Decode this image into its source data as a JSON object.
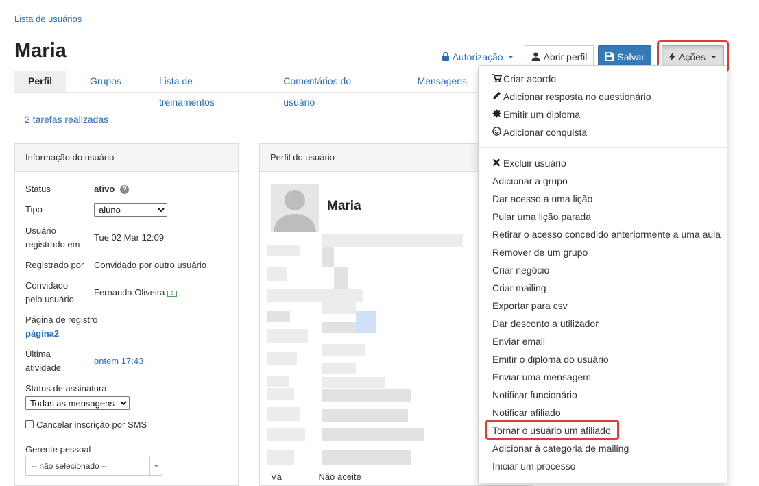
{
  "breadcrumb": "Lista de usuários",
  "title": "Maria",
  "top_actions": {
    "authorization_label": "Autorização",
    "open_profile_label": "Abrir perfil",
    "save_label": "Salvar",
    "actions_label": "Ações"
  },
  "tabs": [
    {
      "label": "Perfil",
      "active": true
    },
    {
      "label": "Grupos"
    },
    {
      "label": "Lista de treinamentos"
    },
    {
      "label": "Comentários do usuário"
    },
    {
      "label": "Mensagens"
    }
  ],
  "tasks_link": "2 tarefas realizadas",
  "user_info": {
    "panel_title": "Informação do usuário",
    "status_label": "Status",
    "status_value": "ativo",
    "type_label": "Tipo",
    "type_value": "aluno",
    "registered_at_label_1": "Usuário",
    "registered_at_label_2": "registrado em",
    "registered_at_value": "Tue 02 Mar 12:09",
    "registered_by_label": "Registrado por",
    "registered_by_value": "Convidado por outro usuário",
    "invited_by_label_1": "Convidado",
    "invited_by_label_2": "pelo usuário",
    "invited_by_value": "Fernanda Oliveira",
    "reg_page_label": "Página de registro",
    "reg_page_value": "página2",
    "last_activity_label_1": "Última",
    "last_activity_label_2": "atividade",
    "last_activity_value": "ontem 17:43",
    "subscription_label": "Status de assinatura",
    "subscription_value": "Todas as mensagens",
    "sms_label": "Cancelar inscrição por SMS",
    "manager_label": "Gerente pessoal",
    "manager_value": "-- não selecionado --"
  },
  "user_profile": {
    "panel_title": "Perfil do usuário",
    "name": "Maria",
    "footer_text_1": "Vá",
    "footer_text_2": "Não aceite"
  },
  "actions_menu": {
    "group1": [
      {
        "label": "Criar acordo",
        "icon": "cart-icon"
      },
      {
        "label": "Adicionar resposta no questionário",
        "icon": "pencil-icon"
      },
      {
        "label": "Emitir um diploma",
        "icon": "certificate-icon"
      },
      {
        "label": "Adicionar conquista",
        "icon": "smile-icon"
      }
    ],
    "group2": [
      {
        "label": "Excluir usuário",
        "icon": "close-icon"
      },
      {
        "label": "Adicionar a grupo"
      },
      {
        "label": "Dar acesso a uma lição"
      },
      {
        "label": "Pular uma lição parada"
      },
      {
        "label": "Retirar o acesso concedido anteriormente a uma aula"
      },
      {
        "label": "Remover de um grupo"
      },
      {
        "label": "Criar negócio"
      },
      {
        "label": "Criar mailing"
      },
      {
        "label": "Exportar para csv"
      },
      {
        "label": "Dar desconto a utilizador"
      },
      {
        "label": "Enviar email"
      },
      {
        "label": "Emitir o diploma do usuário"
      },
      {
        "label": "Enviar uma mensagem"
      },
      {
        "label": "Notificar funcionário"
      },
      {
        "label": "Notificar afiliado"
      },
      {
        "label": "Tornar o usuário um afiliado",
        "highlighted": true
      },
      {
        "label": "Adicionar à categoria de mailing"
      },
      {
        "label": "Iniciar um processo"
      }
    ]
  },
  "colors": {
    "link": "#2a6ebb",
    "primary_button": "#337ab7",
    "highlight": "#e03a3a"
  }
}
